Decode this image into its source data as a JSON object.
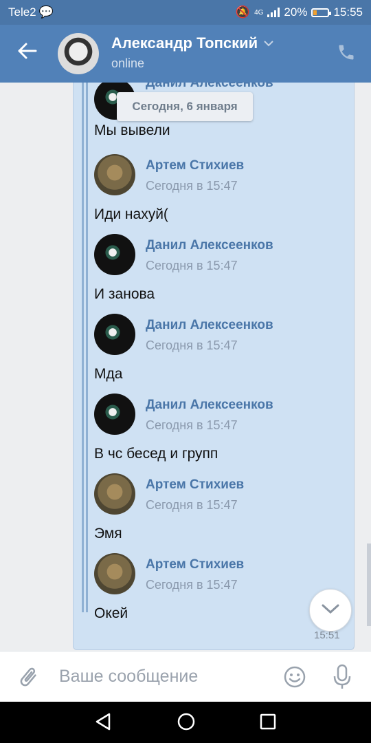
{
  "status_bar": {
    "carrier": "Tele2",
    "network": "4G",
    "battery": "20%",
    "time": "15:55"
  },
  "header": {
    "contact_name": "Александр Топский",
    "status": "online"
  },
  "feed": {
    "date_label": "Сегодня, 6 января",
    "top_partial": {
      "author": "Данил Алексеенков",
      "text": "Мы вывели"
    },
    "messages": [
      {
        "author": "Артем Стихиев",
        "time": "Сегодня в 15:47",
        "text": "Иди нахуй("
      },
      {
        "author": "Данил Алексеенков",
        "time": "Сегодня в 15:47",
        "text": "И занова"
      },
      {
        "author": "Данил Алексеенков",
        "time": "Сегодня в 15:47",
        "text": "Мда"
      },
      {
        "author": "Данил Алексеенков",
        "time": "Сегодня в 15:47",
        "text": "В чс бесед и групп"
      },
      {
        "author": "Артем Стихиев",
        "time": "Сегодня в 15:47",
        "text": "Эмя"
      },
      {
        "author": "Артем Стихиев",
        "time": "Сегодня в 15:47",
        "text": "Окей"
      }
    ],
    "message_time": "15:51"
  },
  "composer": {
    "placeholder": "Ваше сообщение"
  },
  "colors": {
    "header_bg": "#5181b8",
    "statusbar_bg": "#4a76a8",
    "bubble_bg": "#cfe1f3",
    "author_color": "#4a76a8"
  },
  "icons": [
    "back-arrow-icon",
    "chevron-down-icon",
    "phone-icon",
    "attach-icon",
    "smile-icon",
    "mic-icon",
    "scroll-down-icon",
    "nav-back-icon",
    "nav-home-icon",
    "nav-recent-icon"
  ]
}
